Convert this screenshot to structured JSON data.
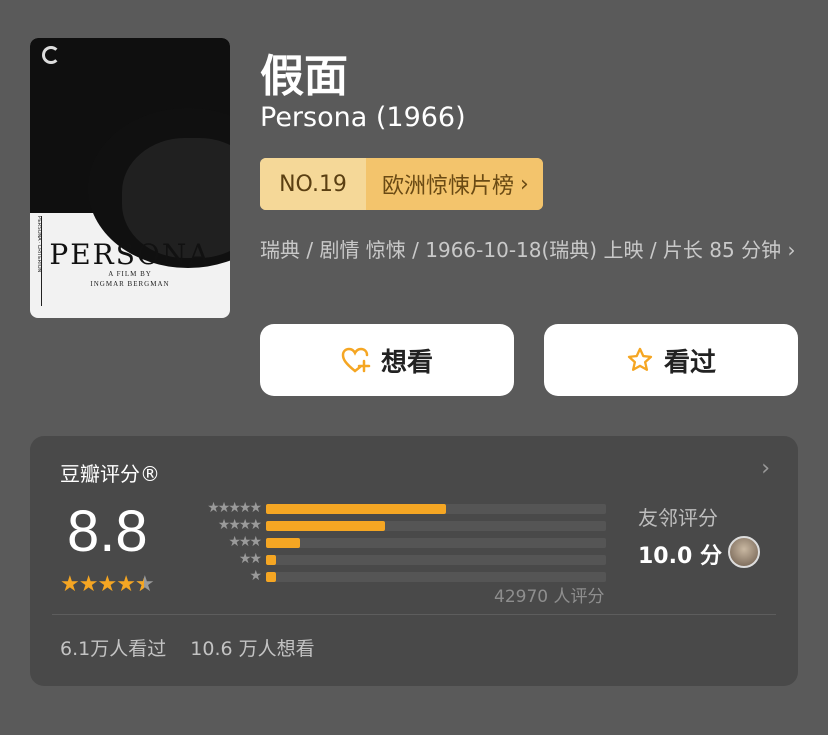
{
  "poster": {
    "title": "PERSONA",
    "line1": "A FILM BY",
    "line2": "INGMAR BERGMAN",
    "spine": "PERSONA · CRITERION"
  },
  "movie": {
    "title_cn": "假面",
    "title_en": "Persona (1966)"
  },
  "rank": {
    "number": "NO.19",
    "list": "欧洲惊悚片榜",
    "chevron": "›"
  },
  "meta": {
    "text": "瑞典 / 剧情 惊悚 / 1966-10-18(瑞典) 上映 / 片长 85 分钟",
    "chevron": "›"
  },
  "buttons": {
    "want": "想看",
    "seen": "看过"
  },
  "rating": {
    "title": "豆瓣评分®",
    "score": "8.8",
    "stars": 4.5,
    "distribution": [
      {
        "stars": 5,
        "label": "★★★★★",
        "fraction": 0.53
      },
      {
        "stars": 4,
        "label": "★★★★",
        "fraction": 0.35
      },
      {
        "stars": 3,
        "label": "★★★",
        "fraction": 0.1
      },
      {
        "stars": 2,
        "label": "★★",
        "fraction": 0.03
      },
      {
        "stars": 1,
        "label": "★",
        "fraction": 0.03
      }
    ],
    "vote_count": "42970 人评分",
    "friend_label": "友邻评分",
    "friend_score": "10.0 分",
    "chevron": "›"
  },
  "stats": {
    "seen": "6.1万人看过",
    "want": "10.6 万人想看"
  },
  "colors": {
    "background": "#5a5a5a",
    "accent": "#f5a623",
    "card": "#494949"
  }
}
